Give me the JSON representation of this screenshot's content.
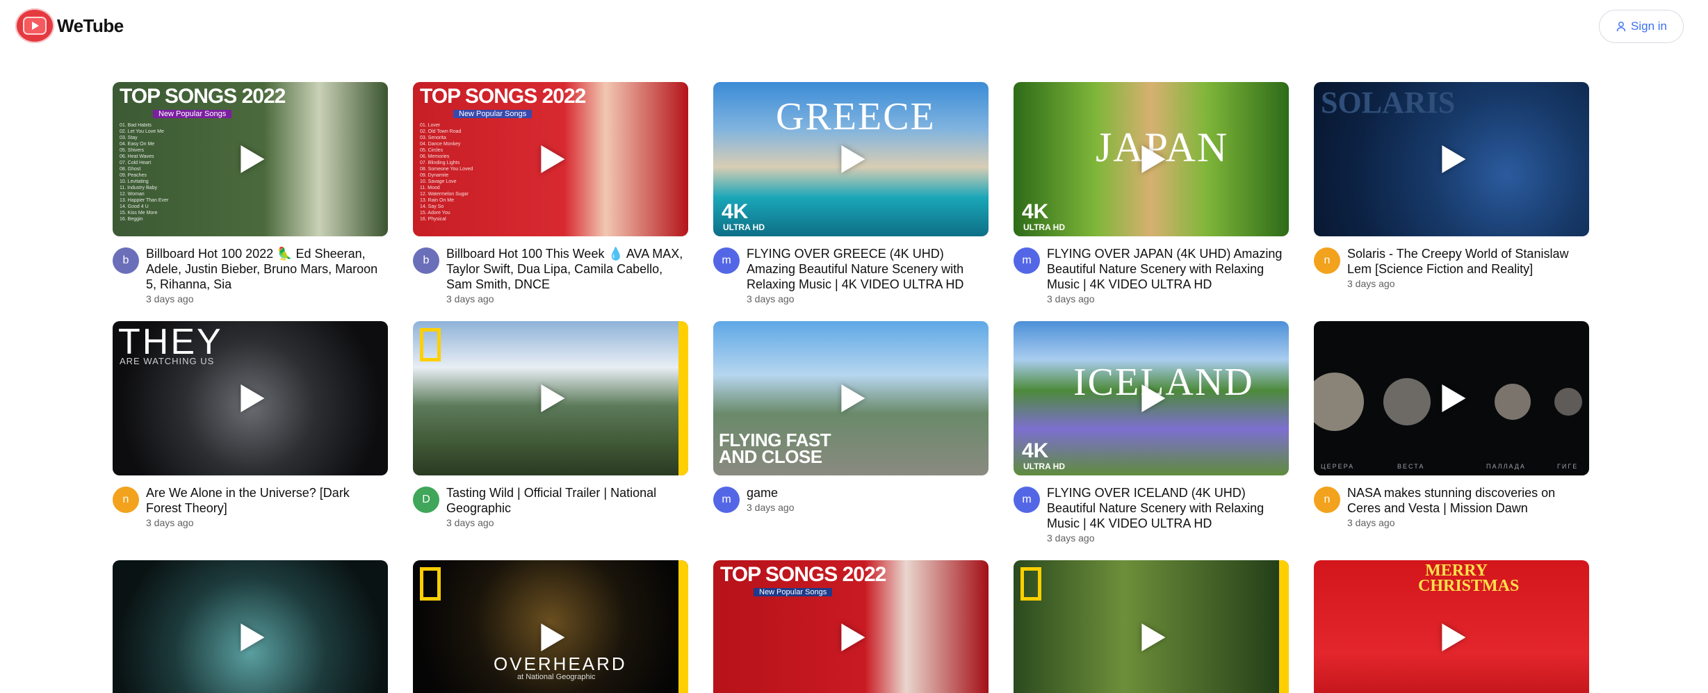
{
  "app": {
    "name": "WeTube"
  },
  "header": {
    "signin_label": "Sign in"
  },
  "colors": {
    "accent": "#3b6ff0",
    "logo_red": "#e53940"
  },
  "videos": [
    {
      "title": "Billboard Hot 100 2022 🦜 Ed Sheeran, Adele, Justin Bieber, Bruno Mars, Maroon 5, Rihanna, Sia",
      "date": "3 days ago",
      "avatar": "b",
      "avatar_color": "#6b6fba",
      "thumb_text": "TOP SONGS 2022",
      "thumb_sub": "New Popular Songs"
    },
    {
      "title": "Billboard Hot 100 This Week 💧 AVA MAX, Taylor Swift, Dua Lipa, Camila Cabello, Sam Smith, DNCE",
      "date": "3 days ago",
      "avatar": "b",
      "avatar_color": "#6b6fba",
      "thumb_text": "TOP SONGS 2022",
      "thumb_sub": "New Popular Songs"
    },
    {
      "title": "FLYING OVER GREECE (4K UHD) Amazing Beautiful Nature Scenery with Relaxing Music | 4K VIDEO ULTRA HD",
      "date": "3 days ago",
      "avatar": "m",
      "avatar_color": "#5367e6",
      "thumb_text": "GREECE",
      "thumb_badge": "4K",
      "thumb_badge_sub": "ULTRA HD"
    },
    {
      "title": "FLYING OVER JAPAN (4K UHD) Amazing Beautiful Nature Scenery with Relaxing Music | 4K VIDEO ULTRA HD",
      "date": "3 days ago",
      "avatar": "m",
      "avatar_color": "#5367e6",
      "thumb_text": "JAPAN",
      "thumb_badge": "4K",
      "thumb_badge_sub": "ULTRA HD"
    },
    {
      "title": "Solaris - The Creepy World of Stanislaw Lem [Science Fiction and Reality]",
      "date": "3 days ago",
      "avatar": "n",
      "avatar_color": "#f2a21c",
      "thumb_text": "SOLARIS"
    },
    {
      "title": "Are We Alone in the Universe? [Dark Forest Theory]",
      "date": "3 days ago",
      "avatar": "n",
      "avatar_color": "#f2a21c",
      "thumb_text": "THEY",
      "thumb_sub": "ARE WATCHING US"
    },
    {
      "title": "Tasting Wild | Official Trailer | National Geographic",
      "date": "3 days ago",
      "avatar": "D",
      "avatar_color": "#3fa65a"
    },
    {
      "title": "game",
      "date": "3 days ago",
      "avatar": "m",
      "avatar_color": "#5367e6",
      "thumb_text": "FLYING FAST",
      "thumb_sub": "AND CLOSE"
    },
    {
      "title": "FLYING OVER ICELAND (4K UHD) Beautiful Nature Scenery with Relaxing Music | 4K VIDEO ULTRA HD",
      "date": "3 days ago",
      "avatar": "m",
      "avatar_color": "#5367e6",
      "thumb_text": "ICELAND",
      "thumb_badge": "4K",
      "thumb_badge_sub": "ULTRA HD"
    },
    {
      "title": "NASA makes stunning discoveries on Ceres and Vesta | Mission Dawn",
      "date": "3 days ago",
      "avatar": "n",
      "avatar_color": "#f2a21c",
      "thumb_labels": [
        "ЦЕРЕРА",
        "ВЕСТА",
        "ПАЛЛАДА",
        "ГИГЕ"
      ]
    },
    {
      "title": "",
      "date": "",
      "avatar": "",
      "avatar_color": ""
    },
    {
      "title": "",
      "date": "",
      "avatar": "",
      "avatar_color": "",
      "thumb_text": "OVERHEARD",
      "thumb_sub": "at National Geographic"
    },
    {
      "title": "",
      "date": "",
      "avatar": "",
      "avatar_color": "",
      "thumb_text": "TOP SONGS 2022",
      "thumb_sub": "New Popular Songs"
    },
    {
      "title": "",
      "date": "",
      "avatar": "",
      "avatar_color": ""
    },
    {
      "title": "",
      "date": "",
      "avatar": "",
      "avatar_color": "",
      "thumb_text": "MERRY CHRISTMAS"
    }
  ]
}
